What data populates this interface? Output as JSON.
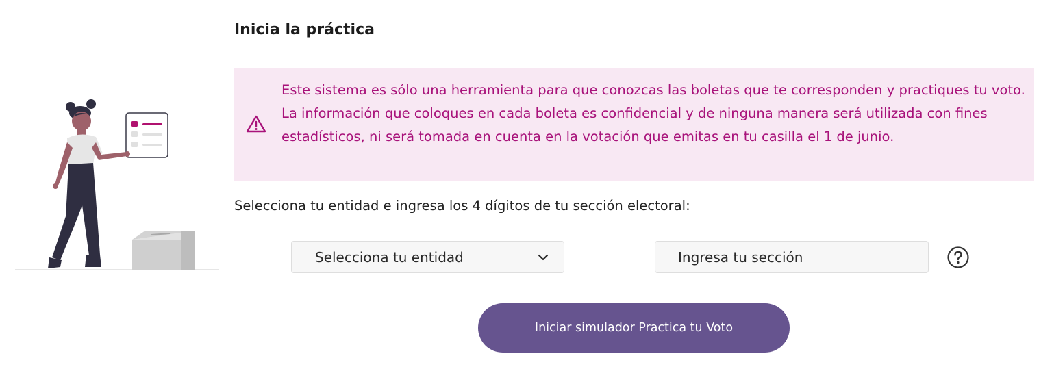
{
  "heading": "Inicia la práctica",
  "alert": {
    "icon": "warning-triangle-icon",
    "text": "Este sistema es sólo una herramienta para que conozcas las boletas que te corresponden y practiques tu voto. La información que coloques en cada boleta es confidencial y de ninguna manera será utilizada con fines estadísticos, ni será tomada en cuenta en la votación que emitas en tu casilla el 1 de junio.",
    "background": "#f8e8f3",
    "text_color": "#a8127a"
  },
  "instructions": "Selecciona tu entidad e ingresa los 4 dígitos de tu sección electoral:",
  "entity_select": {
    "selected": "Selecciona tu entidad",
    "icon": "chevron-down-icon"
  },
  "section_input": {
    "placeholder": "Ingresa tu sección",
    "value": ""
  },
  "help": {
    "icon": "question-circle-icon"
  },
  "start_button": {
    "label": "Iniciar simulador Practica tu Voto",
    "color": "#66548f"
  },
  "illustration": {
    "icon": "woman-voting-illustration"
  }
}
